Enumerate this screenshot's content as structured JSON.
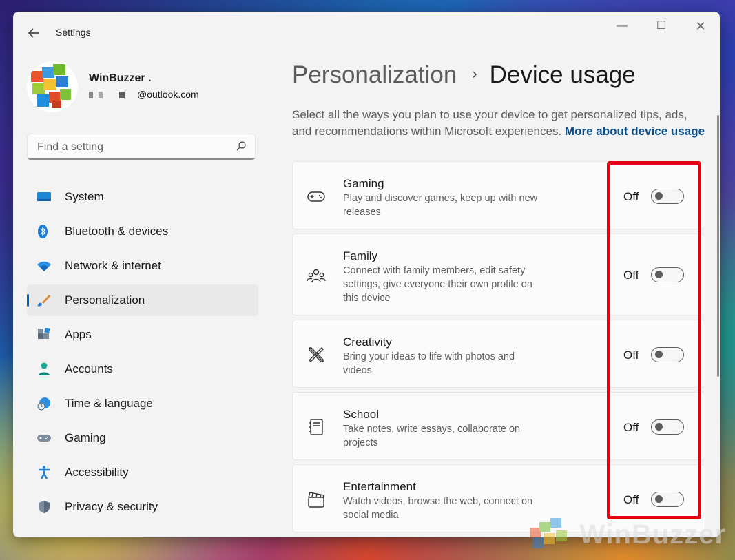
{
  "window": {
    "title": "Settings",
    "controls": [
      "—",
      "☐",
      "✕"
    ]
  },
  "profile": {
    "name": "WinBuzzer .",
    "email_suffix": "@outlook.com"
  },
  "search": {
    "placeholder": "Find a setting"
  },
  "sidebar": {
    "items": [
      {
        "label": "System",
        "icon": "system-icon",
        "active": false
      },
      {
        "label": "Bluetooth & devices",
        "icon": "bluetooth-icon",
        "active": false
      },
      {
        "label": "Network & internet",
        "icon": "wifi-icon",
        "active": false
      },
      {
        "label": "Personalization",
        "icon": "brush-icon",
        "active": true
      },
      {
        "label": "Apps",
        "icon": "apps-icon",
        "active": false
      },
      {
        "label": "Accounts",
        "icon": "accounts-icon",
        "active": false
      },
      {
        "label": "Time & language",
        "icon": "globe-clock-icon",
        "active": false
      },
      {
        "label": "Gaming",
        "icon": "gamepad-icon",
        "active": false
      },
      {
        "label": "Accessibility",
        "icon": "accessibility-icon",
        "active": false
      },
      {
        "label": "Privacy & security",
        "icon": "shield-icon",
        "active": false
      }
    ]
  },
  "main": {
    "breadcrumb_parent": "Personalization",
    "breadcrumb_separator": "›",
    "breadcrumb_current": "Device usage",
    "description": "Select all the ways you plan to use your device to get personalized tips, ads, and recommendations within Microsoft experiences.",
    "more_link": "More about device usage",
    "options": [
      {
        "title": "Gaming",
        "description": "Play and discover games, keep up with new releases",
        "state": "Off",
        "icon": "gamepad-icon"
      },
      {
        "title": "Family",
        "description": "Connect with family members, edit safety settings, give everyone their own profile on this device",
        "state": "Off",
        "icon": "family-icon"
      },
      {
        "title": "Creativity",
        "description": "Bring your ideas to life with photos and videos",
        "state": "Off",
        "icon": "pen-ruler-icon"
      },
      {
        "title": "School",
        "description": "Take notes, write essays, collaborate on projects",
        "state": "Off",
        "icon": "notebook-icon"
      },
      {
        "title": "Entertainment",
        "description": "Watch videos, browse the web, connect on social media",
        "state": "Off",
        "icon": "clapperboard-icon"
      }
    ]
  },
  "watermark": {
    "text": "WinBuzzer"
  },
  "colors": {
    "accent": "#0067c0",
    "link": "#0a4f8c",
    "highlight": "#e3000f",
    "window_bg": "#f3f3f3"
  }
}
